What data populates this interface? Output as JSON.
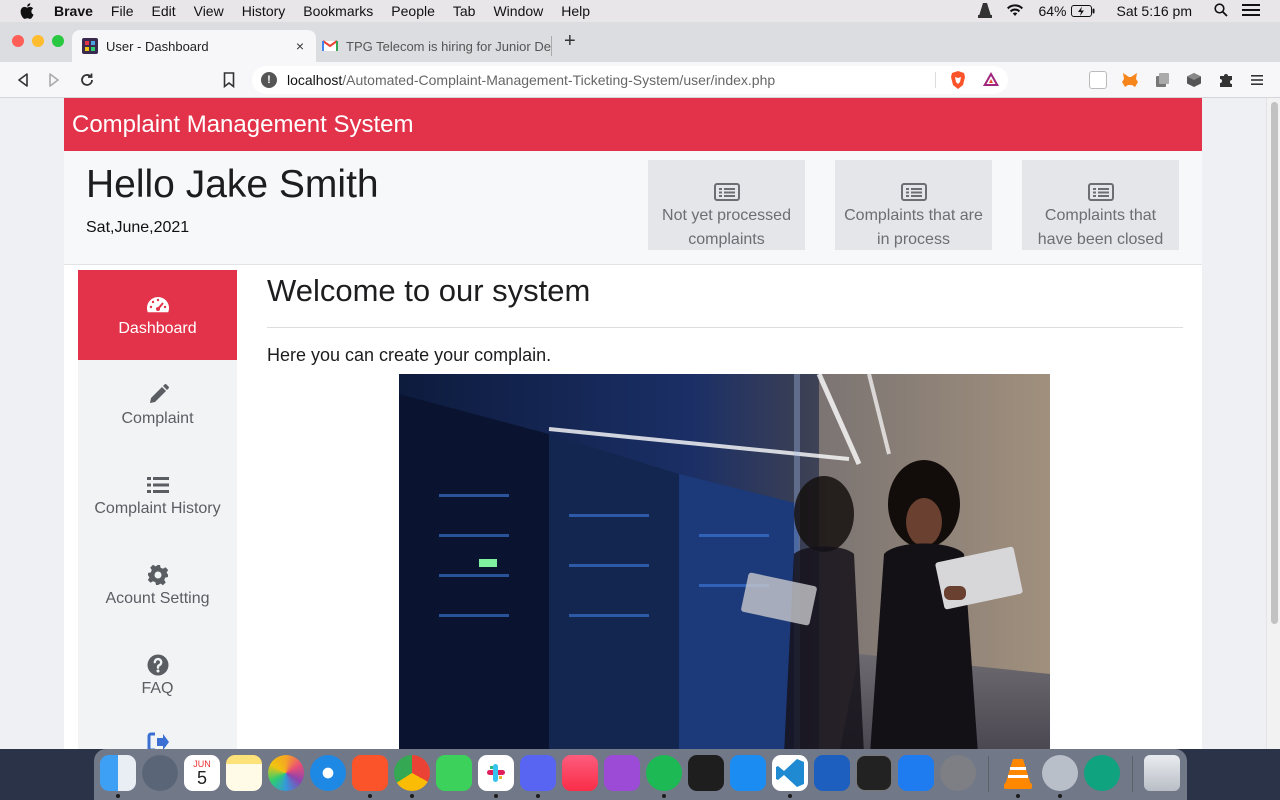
{
  "menubar": {
    "app": "Brave",
    "items": [
      "File",
      "Edit",
      "View",
      "History",
      "Bookmarks",
      "People",
      "Tab",
      "Window",
      "Help"
    ],
    "battery": "64%",
    "clock": "Sat 5:16 pm"
  },
  "browser": {
    "tabs": [
      {
        "title": "User - Dashboard",
        "close": "×"
      },
      {
        "title": "TPG Telecom is hiring for Junior De"
      }
    ],
    "new_tab": "+",
    "url_host": "localhost",
    "url_path": "/Automated-Complaint-Management-Ticketing-System/user/index.php"
  },
  "page": {
    "brand": "Complaint Management System",
    "greeting": "Hello Jake Smith",
    "date": "Sat,June,2021",
    "stats": [
      {
        "line1": "Not yet processed",
        "line2": "complaints",
        "icon": "list-alt-icon"
      },
      {
        "line1": "Complaints that are",
        "line2": "in process",
        "icon": "list-alt-icon"
      },
      {
        "line1": "Complaints that",
        "line2": "have been closed",
        "icon": "list-alt-icon"
      }
    ],
    "sidebar": [
      {
        "label": "Dashboard",
        "icon": "tachometer-icon",
        "active": true
      },
      {
        "label": "Complaint",
        "icon": "pencil-icon"
      },
      {
        "label": "Complaint History",
        "icon": "list-icon"
      },
      {
        "label": "Acount Setting",
        "icon": "gear-icon"
      },
      {
        "label": "FAQ",
        "icon": "question-circle-icon"
      }
    ],
    "welcome_title": "Welcome to our system",
    "welcome_sub": "Here you can create your complain.",
    "accent_color": "#e3334a"
  },
  "dock": {
    "calendar_month": "JUN",
    "calendar_day": "5",
    "apps": [
      "Finder",
      "Launchpad",
      "Calendar",
      "Notes",
      "Photos",
      "Safari",
      "Brave",
      "Chrome",
      "FaceTime",
      "Slack",
      "Discord",
      "Music",
      "Podcasts",
      "Spotify",
      "Figma",
      "App Store",
      "VS Code",
      "Word",
      "Terminal",
      "Xcode",
      "System Preferences",
      "VLC",
      "Preferences",
      "ChatGPT",
      "Trash"
    ]
  }
}
